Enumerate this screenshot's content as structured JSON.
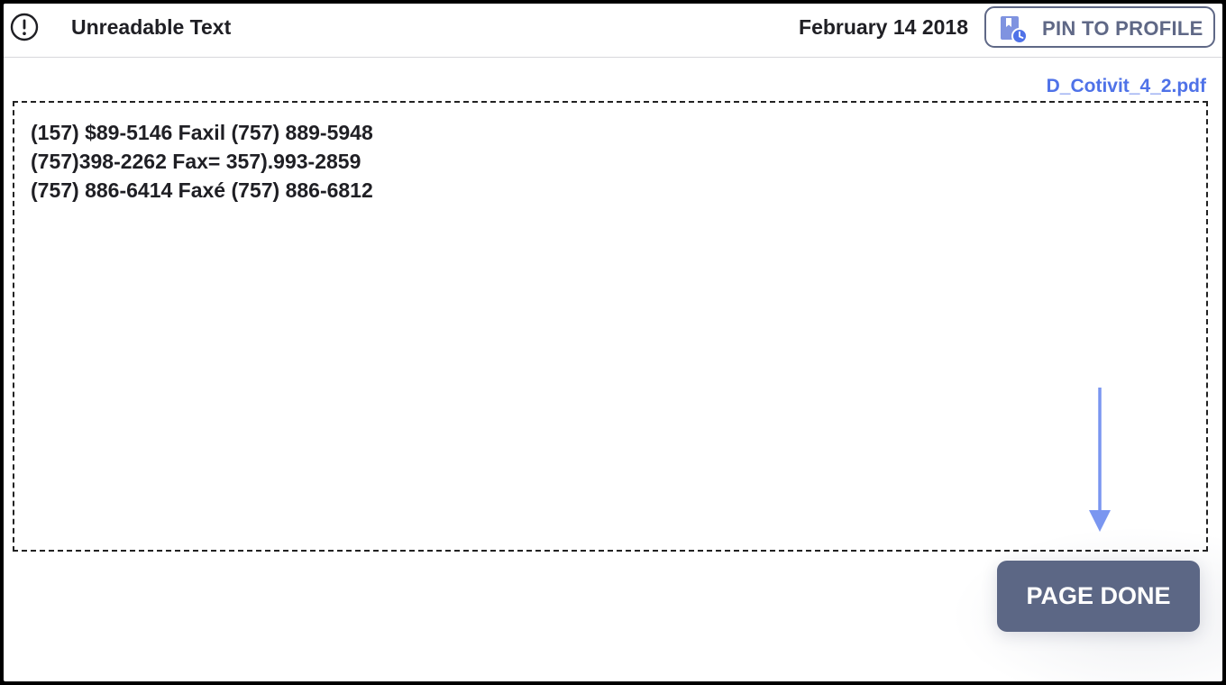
{
  "header": {
    "title": "Unreadable Text",
    "date": "February 14 2018",
    "pin_label": "PIN TO PROFILE",
    "alert_icon": "alert-circle-icon",
    "pin_icon": "pin-clock-icon"
  },
  "document": {
    "filename": "D_Cotivit_4_2.pdf",
    "lines": [
      "(157) $89-5146 Faxil (757) 889-5948",
      "(757)398-2262 Fax= 357).993-2859",
      "(757) 886-6414 Faxé (757) 886-6812"
    ]
  },
  "actions": {
    "page_done_label": "PAGE DONE"
  },
  "colors": {
    "accent": "#4f72e8",
    "button": "#5c6785",
    "pin_border": "#5f6886",
    "arrow": "#7a96f0"
  }
}
